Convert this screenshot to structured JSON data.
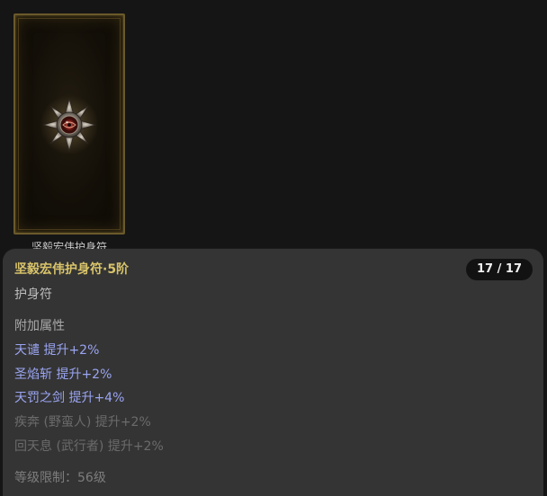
{
  "item_card": {
    "caption": "坚毅宏伟护身符",
    "icon": "amulet-icon"
  },
  "tooltip": {
    "title": "坚毅宏伟护身符·5阶",
    "counter": "17 / 17",
    "type": "护身符",
    "section_label": "附加属性",
    "attributes_active": [
      "天谴 提升+2%",
      "圣焰斩 提升+2%",
      "天罚之剑 提升+4%"
    ],
    "attributes_inactive": [
      "疾奔 (野蛮人) 提升+2%",
      "回天息 (武行者) 提升+2%"
    ],
    "requirement": "等级限制：56级"
  },
  "colors": {
    "title": "#d8c36a",
    "active_attribute": "#9aa5f2",
    "inactive_attribute": "#6b6b6b",
    "panel_background": "#343434",
    "page_background": "#151515",
    "card_border": "#6b5a2a"
  }
}
